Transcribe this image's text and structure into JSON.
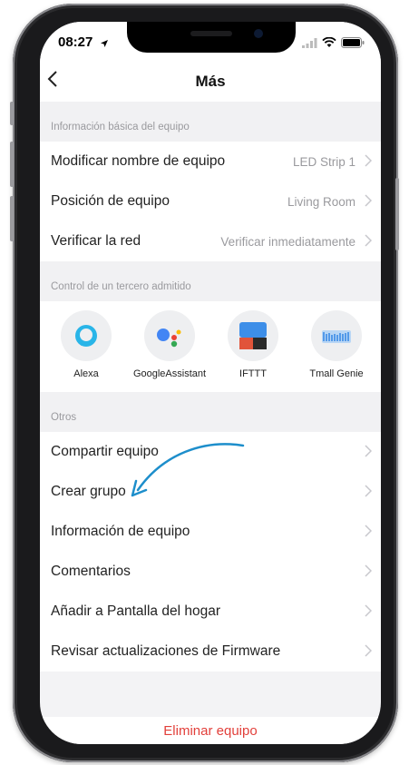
{
  "status": {
    "time": "08:27"
  },
  "nav": {
    "title": "Más"
  },
  "sections": {
    "basic": "Información básica del equipo",
    "third": "Control de un tercero admitido",
    "others": "Otros"
  },
  "basic_rows": [
    {
      "label": "Modificar nombre de equipo",
      "value": "LED Strip 1"
    },
    {
      "label": "Posición de equipo",
      "value": "Living Room"
    },
    {
      "label": "Verificar la red",
      "value": "Verificar inmediatamente"
    }
  ],
  "third_party": [
    {
      "name": "Alexa",
      "icon": "alexa-icon"
    },
    {
      "name": "GoogleAssistant",
      "icon": "google-assistant-icon"
    },
    {
      "name": "IFTTT",
      "icon": "ifttt-icon"
    },
    {
      "name": "Tmall Genie",
      "icon": "tmall-genie-icon"
    }
  ],
  "other_rows": [
    {
      "label": "Compartir equipo"
    },
    {
      "label": "Crear grupo"
    },
    {
      "label": "Información de equipo"
    },
    {
      "label": "Comentarios"
    },
    {
      "label": "Añadir a Pantalla del hogar"
    },
    {
      "label": "Revisar actualizaciones de Firmware"
    }
  ],
  "delete_label": "Eliminar equipo",
  "colors": {
    "accent_red": "#e2403b",
    "annotation_arrow": "#1d8ecb",
    "alexa": "#29b5e8"
  }
}
